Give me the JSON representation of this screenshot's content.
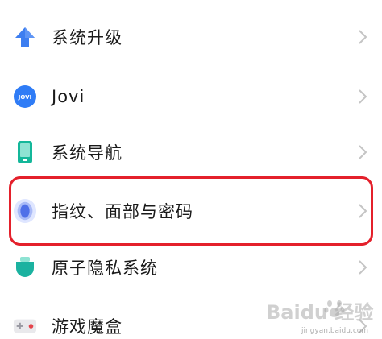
{
  "menu": {
    "items": [
      {
        "label": "系统升级",
        "icon": "upgrade-arrow-icon"
      },
      {
        "label": "Jovi",
        "icon": "jovi-icon",
        "icon_text": "JOVI"
      },
      {
        "label": "系统导航",
        "icon": "phone-navigation-icon"
      },
      {
        "label": "指纹、面部与密码",
        "icon": "fingerprint-icon"
      },
      {
        "label": "原子隐私系统",
        "icon": "privacy-shield-icon"
      },
      {
        "label": "游戏魔盒",
        "icon": "game-box-icon"
      }
    ]
  },
  "watermark": {
    "text": "Baidu 经验",
    "url": "jingyan.baidu.com"
  },
  "colors": {
    "highlight": "#e4202b",
    "upgrade_blue": "#3d7ef0",
    "jovi_blue": "#2f7cf6",
    "nav_teal": "#14b79a",
    "fingerprint_blue": "#4f6fe8",
    "privacy_teal": "#1bb2a0",
    "chevron": "#c4c4c4"
  }
}
